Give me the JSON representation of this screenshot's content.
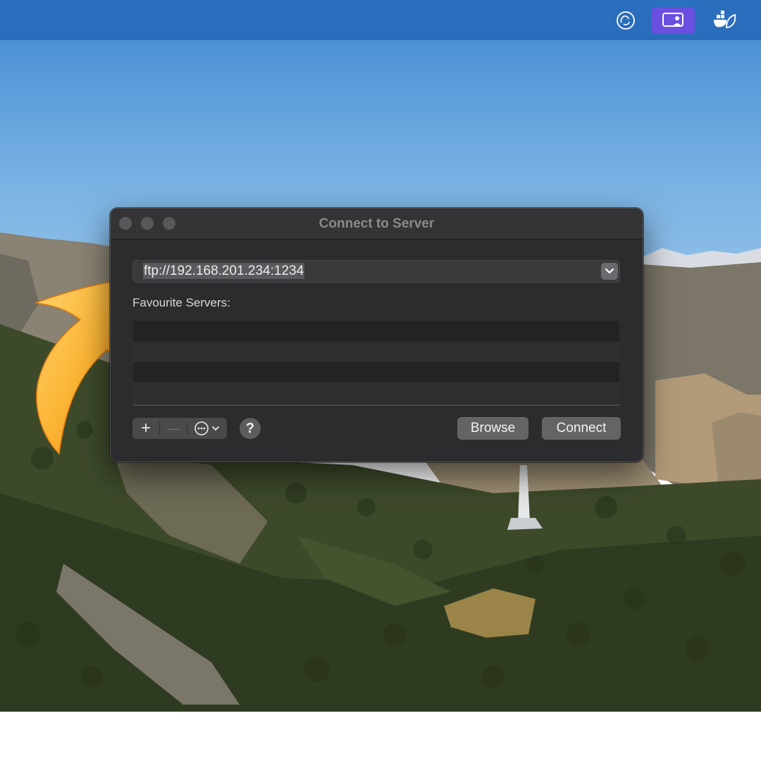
{
  "menubar": {
    "icons": [
      "obs-studio-icon",
      "screen-sharing-icon",
      "docker-leaf-icon"
    ],
    "accent": "#6a4fe0"
  },
  "dialog": {
    "title": "Connect to Server",
    "server_address": {
      "value": "ftp://192.168.201.234:1234"
    },
    "favourites_label": "Favourite Servers:",
    "favourites": [],
    "footer": {
      "add_label": "+",
      "remove_label": "—",
      "help_label": "?",
      "browse_label": "Browse",
      "connect_label": "Connect"
    }
  },
  "colors": {
    "dialog_bg": "#2c2c2e",
    "button_bg": "#646467",
    "menubar_bg": "#2b6fbf",
    "arrow": "#f7a21b"
  }
}
